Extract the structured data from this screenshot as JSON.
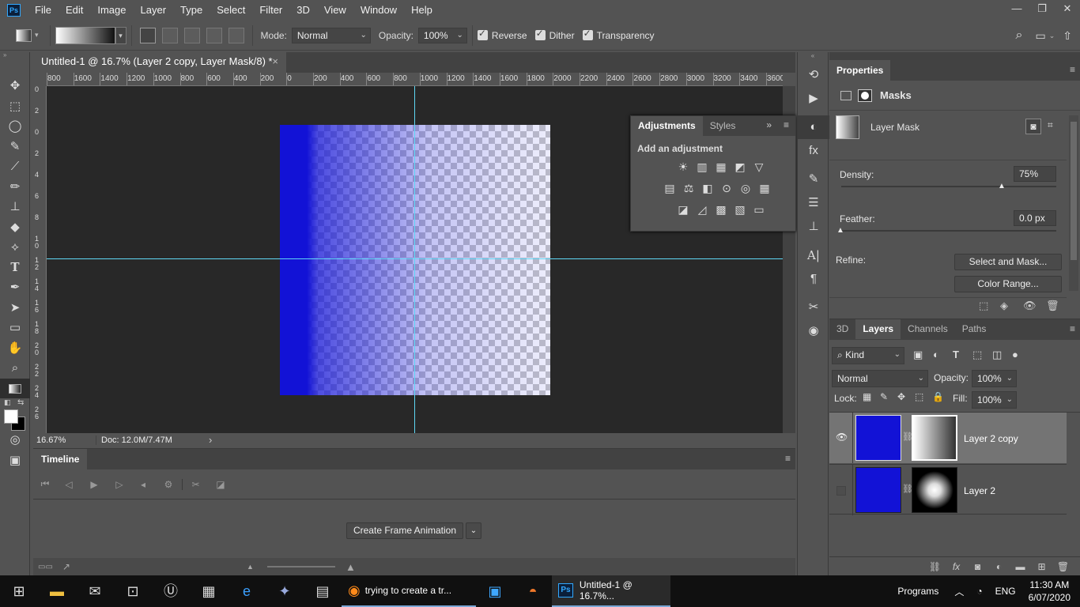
{
  "menu": {
    "app_icon": "Ps",
    "items": [
      "File",
      "Edit",
      "Image",
      "Layer",
      "Type",
      "Select",
      "Filter",
      "3D",
      "View",
      "Window",
      "Help"
    ],
    "window_controls": [
      "—",
      "❐",
      "✕"
    ]
  },
  "options": {
    "mode_label": "Mode:",
    "mode_value": "Normal",
    "opacity_label": "Opacity:",
    "opacity_value": "100%",
    "reverse_label": "Reverse",
    "dither_label": "Dither",
    "transparency_label": "Transparency"
  },
  "document": {
    "tab_title": "Untitled-1 @ 16.7% (Layer 2 copy, Layer Mask/8) *",
    "close": "×",
    "ruler_h": [
      "800",
      "1600",
      "1400",
      "1200",
      "1000",
      "800",
      "600",
      "400",
      "200",
      "0",
      "200",
      "400",
      "600",
      "800",
      "1000",
      "1200",
      "1400",
      "1600",
      "1800",
      "2000",
      "2200",
      "2400",
      "2600",
      "2800",
      "3000",
      "3200",
      "3400",
      "3600"
    ],
    "ruler_v": [
      "0",
      "2",
      "0",
      "2",
      "4",
      "6",
      "8",
      "1 0",
      "1 2",
      "1 4",
      "1 6",
      "1 8",
      "2 0",
      "2 2",
      "2 4",
      "2 6"
    ],
    "zoom": "16.67%",
    "doc_info": "Doc: 12.0M/7.47M",
    "arrow": "›"
  },
  "adjustments": {
    "tab_adjustments": "Adjustments",
    "tab_styles": "Styles",
    "heading": "Add an adjustment",
    "row1": [
      "☀",
      "▥",
      "▦",
      "◩",
      "▽"
    ],
    "row2": [
      "▤",
      "⚖",
      "◧",
      "⊙",
      "◎",
      "▦"
    ],
    "row3": [
      "◪",
      "◿",
      "▩",
      "▧",
      "▭"
    ]
  },
  "timeline": {
    "title": "Timeline",
    "create_button": "Create Frame Animation"
  },
  "properties": {
    "title": "Properties",
    "section": "Masks",
    "mask_label": "Layer Mask",
    "density_label": "Density:",
    "density_value": "75%",
    "density_level": 0.75,
    "feather_label": "Feather:",
    "feather_value": "0.0 px",
    "refine_label": "Refine:",
    "select_mask_button": "Select and Mask...",
    "color_range_button": "Color Range..."
  },
  "layers": {
    "tabs": [
      "3D",
      "Layers",
      "Channels",
      "Paths"
    ],
    "active_tab": "Layers",
    "filter_kind": "Kind",
    "blend_mode": "Normal",
    "opacity_label": "Opacity:",
    "opacity_value": "100%",
    "lock_label": "Lock:",
    "fill_label": "Fill:",
    "fill_value": "100%",
    "items": [
      {
        "name": "Layer 2 copy",
        "visible": true,
        "selected": true
      },
      {
        "name": "Layer 2",
        "visible": false,
        "selected": false
      }
    ]
  },
  "taskbar": {
    "firefox_title": "trying to create a tr...",
    "ps_title": "Untitled-1 @ 16.7%...",
    "programs_label": "Programs",
    "lang": "ENG",
    "time": "11:30 AM",
    "date": "6/07/2020"
  },
  "colors": {
    "layer_fill": "#1212d6",
    "guide": "#5fd8f5",
    "ui_bg": "#535353"
  }
}
